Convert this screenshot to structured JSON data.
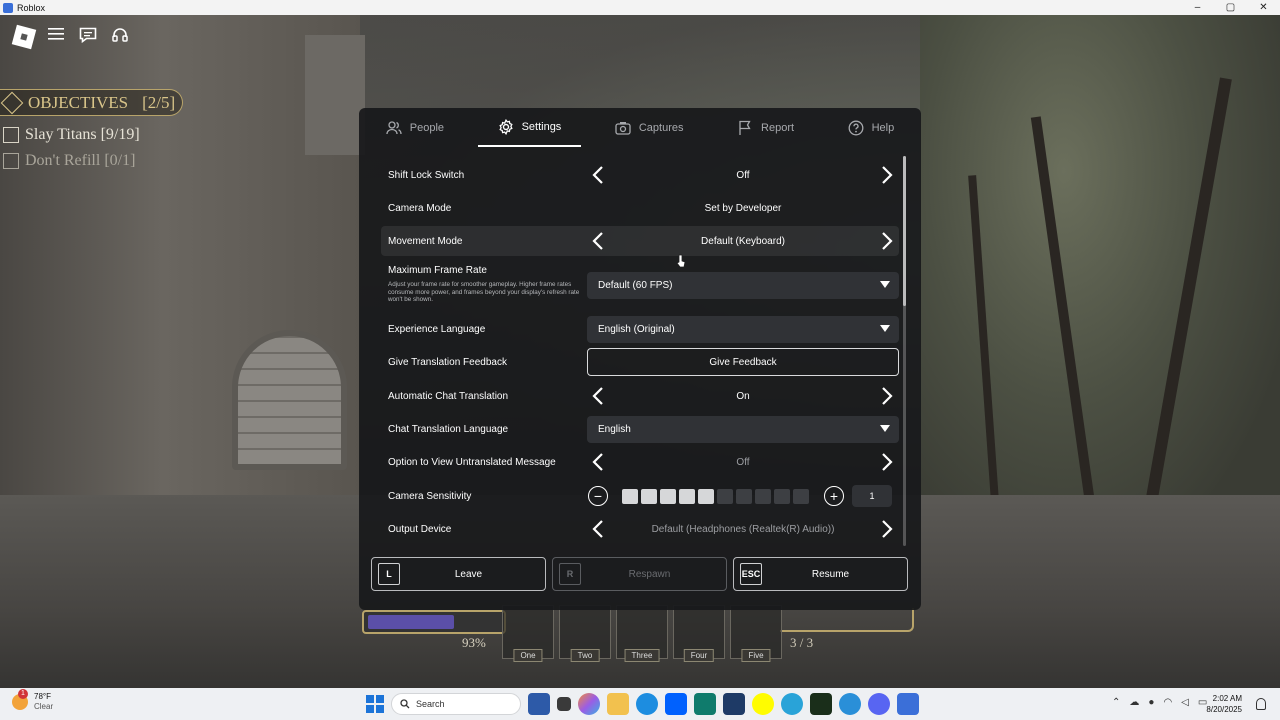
{
  "window": {
    "title": "Roblox"
  },
  "objectives": {
    "title": "OBJECTIVES",
    "count": "[2/5]",
    "tasks": [
      {
        "label": "Slay Titans [9/19]"
      },
      {
        "label": "Don't Refill [0/1]"
      }
    ]
  },
  "menu": {
    "tabs": [
      {
        "label": "People",
        "icon": "people-icon"
      },
      {
        "label": "Settings",
        "icon": "gear-icon"
      },
      {
        "label": "Captures",
        "icon": "camera-icon"
      },
      {
        "label": "Report",
        "icon": "flag-icon"
      },
      {
        "label": "Help",
        "icon": "help-icon"
      }
    ],
    "active_tab": "Settings",
    "settings": {
      "shift_lock": {
        "label": "Shift Lock Switch",
        "value": "Off"
      },
      "camera_mode": {
        "label": "Camera Mode",
        "value": "Set by Developer"
      },
      "movement_mode": {
        "label": "Movement Mode",
        "value": "Default (Keyboard)"
      },
      "max_frame_rate": {
        "label": "Maximum Frame Rate",
        "description": "Adjust your frame rate for smoother gameplay. Higher frame rates consume more power, and frames beyond your display's refresh rate won't be shown.",
        "value": "Default (60 FPS)"
      },
      "experience_language": {
        "label": "Experience Language",
        "value": "English (Original)"
      },
      "translation_feedback": {
        "label": "Give Translation Feedback",
        "button": "Give Feedback"
      },
      "auto_chat_translation": {
        "label": "Automatic Chat Translation",
        "value": "On"
      },
      "chat_translation_language": {
        "label": "Chat Translation Language",
        "value": "English"
      },
      "view_untranslated": {
        "label": "Option to View Untranslated Message",
        "value": "Off"
      },
      "camera_sensitivity": {
        "label": "Camera Sensitivity",
        "value": "1",
        "level": 5,
        "max_level": 10
      },
      "output_device": {
        "label": "Output Device",
        "value": "Default (Headphones (Realtek(R) Audio))"
      }
    },
    "buttons": {
      "leave": {
        "key": "L",
        "label": "Leave"
      },
      "respawn": {
        "key": "R",
        "label": "Respawn"
      },
      "resume": {
        "key": "ESC",
        "label": "Resume"
      }
    }
  },
  "hud": {
    "health_percent": "93%",
    "health_fraction": 0.93,
    "slots": [
      "One",
      "Two",
      "Three",
      "Four",
      "Five"
    ],
    "slot_count": "3 / 3"
  },
  "taskbar": {
    "weather_temp": "78°F",
    "weather_desc": "Clear",
    "weather_badge": "1",
    "search_placeholder": "Search",
    "time": "2:02 AM",
    "date": "8/20/2025"
  },
  "colors": {
    "menu_bg": "#18191b",
    "objective_gold": "#d9c58a",
    "health_fill": "#5b4fa8",
    "accent_blue": "#1c74d8"
  }
}
